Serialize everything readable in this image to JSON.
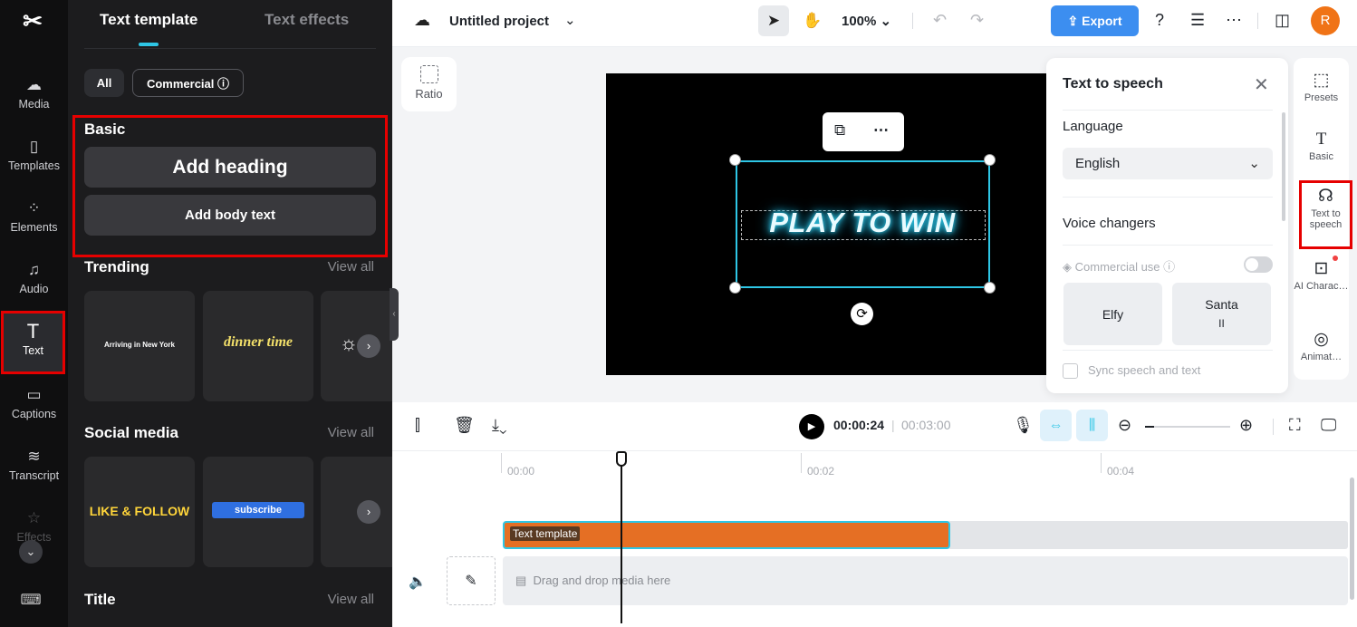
{
  "rail": {
    "logo": "✂",
    "items": [
      {
        "label": "Media",
        "icon": "cloud-upload-icon"
      },
      {
        "label": "Templates",
        "icon": "templates-icon"
      },
      {
        "label": "Elements",
        "icon": "elements-icon"
      },
      {
        "label": "Audio",
        "icon": "music-note-icon"
      },
      {
        "label": "Text",
        "icon": "text-t-icon"
      },
      {
        "label": "Captions",
        "icon": "captions-icon"
      },
      {
        "label": "Transcript",
        "icon": "transcript-icon"
      },
      {
        "label": "Effects",
        "icon": "effects-star-icon"
      }
    ]
  },
  "panel": {
    "tabs": [
      "Text template",
      "Text effects"
    ],
    "filters": {
      "all": "All",
      "commercial": "Commercial ⓘ"
    },
    "basic": {
      "title": "Basic",
      "add_heading": "Add heading",
      "add_body": "Add body text"
    },
    "trending": {
      "title": "Trending",
      "view_all": "View all",
      "cards": [
        "Arriving in New York",
        "dinner time",
        ""
      ]
    },
    "social": {
      "title": "Social media",
      "view_all": "View all",
      "cards": [
        "LIKE & FOLLOW",
        "subscribe",
        ""
      ]
    },
    "title_section": {
      "title": "Title",
      "view_all": "View all"
    }
  },
  "topbar": {
    "project_name": "Untitled project",
    "zoom": "100%",
    "export_label": "Export",
    "avatar_letter": "R"
  },
  "workspace": {
    "ratio_label": "Ratio",
    "canvas_text": "PLAY TO WIN"
  },
  "tts": {
    "title": "Text to speech",
    "language_label": "Language",
    "language_value": "English",
    "voice_changers_label": "Voice changers",
    "commercial_use": "Commercial use ⓘ",
    "voices": [
      "Elfy",
      "Santa"
    ],
    "voice_sub": [
      "",
      "II"
    ],
    "sync": "Sync speech and text"
  },
  "right_rail": [
    {
      "label": "Presets",
      "icon": "presets-icon"
    },
    {
      "label": "Basic",
      "icon": "text-t-icon"
    },
    {
      "label": "Text to speech",
      "icon": "speech-icon"
    },
    {
      "label": "AI Charac…",
      "icon": "ai-character-icon"
    },
    {
      "label": "Animat…",
      "icon": "animation-icon"
    }
  ],
  "timeline": {
    "current_time": "00:00:24",
    "total_time": "00:03:00",
    "ruler": [
      "00:00",
      "00:02",
      "00:04"
    ],
    "clip_label": "Text template",
    "media_placeholder": "Drag and drop media here"
  },
  "colors": {
    "accent": "#2ec6e6",
    "export": "#3c8ef0",
    "clip": "#e56f24",
    "highlight": "#e60000"
  }
}
